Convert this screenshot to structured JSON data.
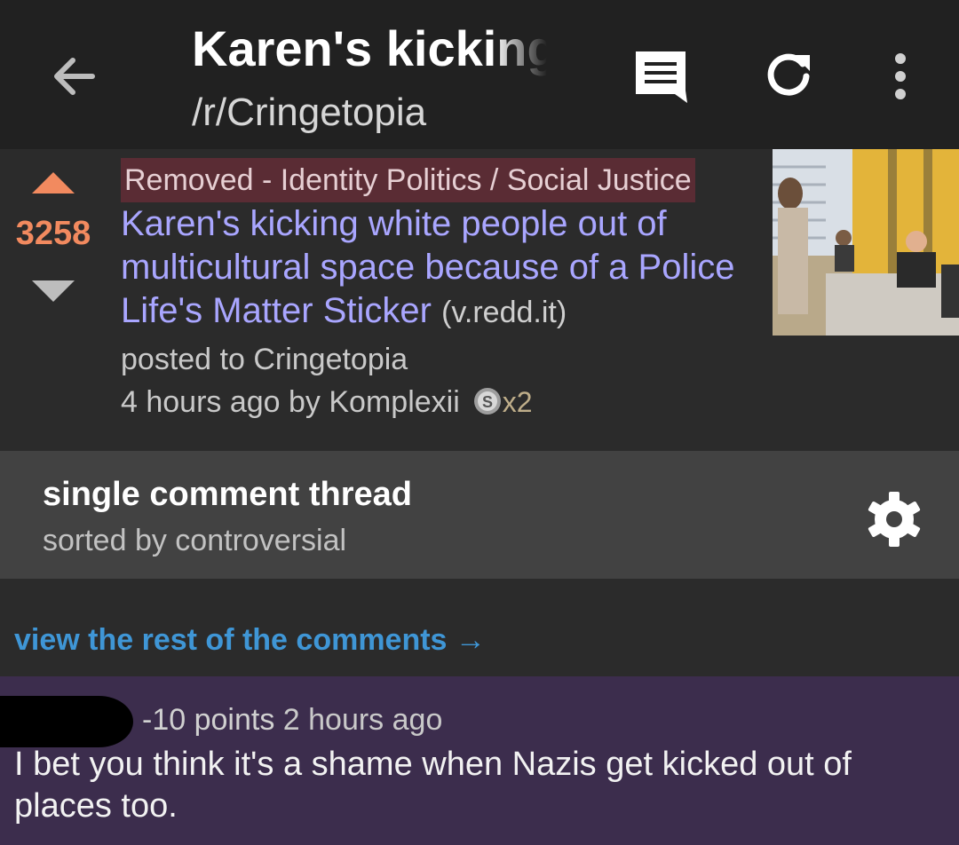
{
  "toolbar": {
    "title": "Karen's kicking",
    "subtitle": "/r/Cringetopia",
    "icons": [
      "back-arrow-icon",
      "comment-icon",
      "refresh-icon",
      "more-vert-icon"
    ]
  },
  "post": {
    "score": "3258",
    "flair": "Removed - Identity Politics / Social Justice",
    "title": "Karen's kicking white people out of multicultural space because of a Police Life's Matter Sticker",
    "domain": "(v.redd.it)",
    "posted_to": "posted to Cringetopia",
    "byline": "4 hours ago by Komplexii",
    "award_count": "x2",
    "colors": {
      "score": "#f28a5f",
      "title": "#a9a6ff",
      "flair_bg": "#5a2c34"
    }
  },
  "thread": {
    "title": "single comment thread",
    "sort": "sorted by controversial"
  },
  "link": {
    "view_rest": "view the rest of the comments →"
  },
  "comment": {
    "points": "-10 points",
    "time": "2 hours ago",
    "body": "I bet you think it's a shame when Nazis get kicked out of places too.",
    "bg_color": "#3c2d4d"
  }
}
